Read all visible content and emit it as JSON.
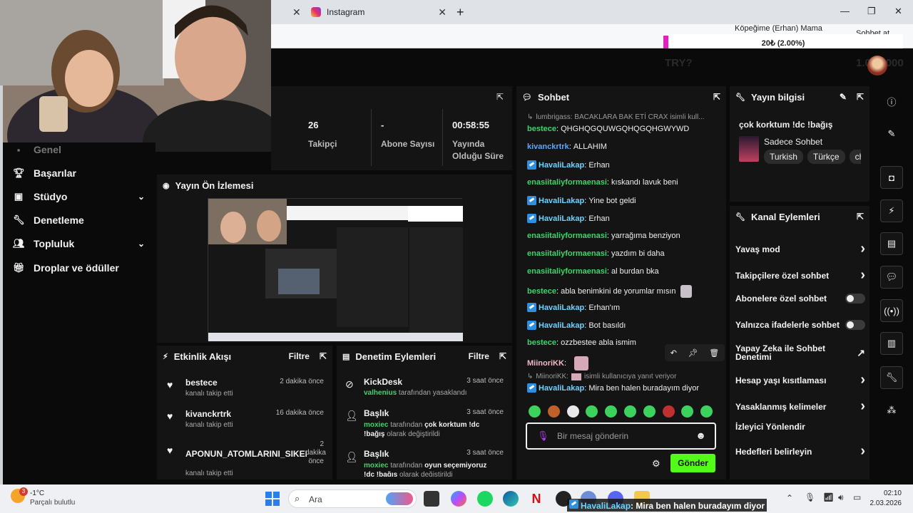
{
  "browser": {
    "tab_instagram": "Instagram",
    "tab_close": "✕",
    "new_tab": "+",
    "donation_title": "Köpeğime (Erhan) Mama",
    "donation_amount": "20₺ (2.00%)",
    "donation_progress": 0.02,
    "addr_right": "Sohbet at"
  },
  "topbar": {
    "faded_text": "TRY?",
    "faded_text2": "1.000.000"
  },
  "stats": [
    {
      "value": "26",
      "label": "Takipçi"
    },
    {
      "value": "-",
      "label": "Abone Sayısı"
    },
    {
      "value": "00:58:55",
      "label": "Yayında Olduğu Süre"
    }
  ],
  "sidebar": {
    "partial_item": "Genel",
    "items": [
      {
        "label": "Başarılar",
        "icon": "trophy-icon"
      },
      {
        "label": "Stüdyo",
        "icon": "studio-icon"
      },
      {
        "label": "Denetleme",
        "icon": "wrench-icon"
      },
      {
        "label": "Topluluk",
        "icon": "community-icon"
      },
      {
        "label": "Droplar ve ödüller",
        "icon": "gift-icon"
      }
    ]
  },
  "preview": {
    "title": "Yayın Ön İzlemesi"
  },
  "activity": {
    "title": "Etkinlik Akışı",
    "filter": "Filtre",
    "items": [
      {
        "name": "bestece",
        "sub": "kanalı takip etti",
        "time": "2 dakika önce"
      },
      {
        "name": "kivanckrtrk",
        "sub": "kanalı takip etti",
        "time": "16 dakika önce"
      },
      {
        "name": "APONUN_ATOMLARINI_SIKEN",
        "sub": "kanalı takip etti",
        "time": "2 dakika önce"
      }
    ]
  },
  "moderation": {
    "title": "Denetim Eylemleri",
    "filter": "Filtre",
    "items": [
      {
        "name": "KickDesk",
        "actor": "valhenius",
        "text": "tarafından yasaklandı",
        "time": "3 saat önce"
      },
      {
        "name": "Başlık",
        "actor": "moxiec",
        "text": "tarafından",
        "bold": "çok korktum !dc !bağış",
        "after": "olarak değiştirildi",
        "time": "3 saat önce"
      },
      {
        "name": "Başlık",
        "actor": "moxiec",
        "text": "tarafından",
        "bold": "oyun seçemiyoruz !dc !bağış",
        "after": "olarak değiştirildi",
        "time": "3 saat önce"
      }
    ]
  },
  "chat": {
    "title": "Sohbet",
    "reply_top": "lumbrigass: BACAKLARA BAK ETİ CRAX isimli kull...",
    "messages": [
      {
        "user": "bestece",
        "text": "QHGHQGQUWGQHQGQHGWYWD",
        "color": "green"
      },
      {
        "user": "kivanckrtrk",
        "text": "ALLAHIM",
        "color": "blue"
      },
      {
        "user": "HavaliLakap",
        "text": "Erhan",
        "color": "teal",
        "badge": true
      },
      {
        "user": "enasiitaliyformaenasi",
        "text": "kıskandı lavuk beni",
        "color": "green"
      },
      {
        "user": "HavaliLakap",
        "text": "Yine bot geldi",
        "color": "teal",
        "badge": true
      },
      {
        "user": "HavaliLakap",
        "text": "Erhan",
        "color": "teal",
        "badge": true
      },
      {
        "user": "enasiitaliyformaenasi",
        "text": "yarrağıma benziyon",
        "color": "green"
      },
      {
        "user": "enasiitaliyformaenasi",
        "text": "yazdım bi daha",
        "color": "green"
      },
      {
        "user": "enasiitaliyformaenasi",
        "text": "al burdan bka",
        "color": "green"
      },
      {
        "user": "bestece",
        "text": "abla benimkini de yorumlar mısın",
        "color": "green"
      },
      {
        "user": "HavaliLakap",
        "text": "Erhan'ım",
        "color": "teal",
        "badge": true
      },
      {
        "user": "HavaliLakap",
        "text": "Bot basıldı",
        "color": "teal",
        "badge": true
      },
      {
        "user": "bestece",
        "text": "ozzbestee abla ismim",
        "color": "green"
      },
      {
        "user": "MiinoriKK",
        "text": "",
        "color": "pink"
      }
    ],
    "reply_bottom_user": "MiinoriKK:",
    "reply_bottom_text": "isimli kullanıcıya yanıt veriyor",
    "last_user": "HavaliLakap",
    "last_text": "Mira ben halen buradayım diyor",
    "input_placeholder": "Bir mesaj gönderin",
    "send": "Gönder"
  },
  "stream_info": {
    "title": "Yayın bilgisi",
    "stream_title": "çok korktum !dc !bağış",
    "category": "Sadece Sohbet",
    "tags": [
      "Turkish",
      "Türkçe",
      "ch"
    ]
  },
  "channel_actions": {
    "title": "Kanal Eylemleri",
    "items": [
      {
        "label": "Yavaş mod",
        "type": "chevron"
      },
      {
        "label": "Takipçilere özel sohbet",
        "type": "chevron"
      },
      {
        "label": "Abonelere özel sohbet",
        "type": "toggle"
      },
      {
        "label": "Yalnızca ifadelerle sohbet",
        "type": "toggle"
      },
      {
        "label": "Yapay Zeka ile Sohbet Denetimi",
        "type": "external"
      },
      {
        "label": "Hesap yaşı kısıtlaması",
        "type": "chevron"
      },
      {
        "label": "Yasaklanmış kelimeler",
        "type": "chevron"
      },
      {
        "label": "İzleyici Yönlendir",
        "type": "none"
      },
      {
        "label": "Hedefleri belirleyin",
        "type": "chevron"
      }
    ]
  },
  "taskbar": {
    "weather_temp": "-1°C",
    "weather_desc": "Parçalı bulutlu",
    "weather_badge": "3",
    "search": "Ara",
    "notif_user": "HavaliLakap",
    "notif_text": "Mira ben halen buradayım diyor",
    "time": "02:10",
    "date": "2.03.2026"
  }
}
